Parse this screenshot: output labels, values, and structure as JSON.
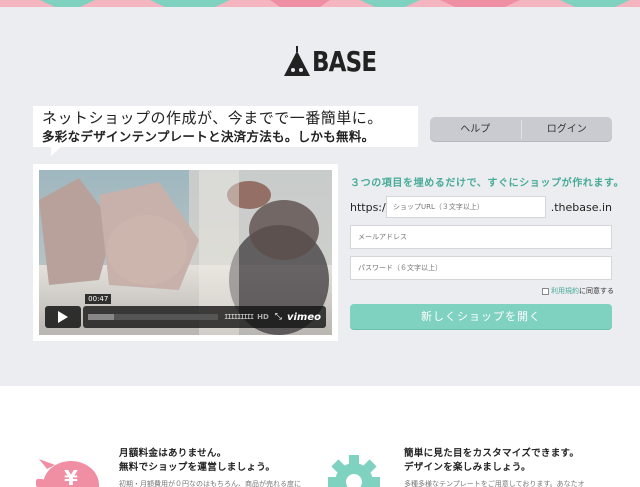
{
  "brand": {
    "name": "BASE"
  },
  "tagline": {
    "line1": "ネットショップの作成が、今までで一番簡単に。",
    "line2": "多彩なデザインテンプレートと決済方法も。しかも無料。"
  },
  "nav": {
    "help": "ヘルプ",
    "login": "ログイン"
  },
  "video": {
    "timecode": "00:47",
    "progress": 0.2,
    "volume_bars": "IIIIIIIII",
    "hd_label": "HD",
    "fullscreen_glyph": "⤡",
    "player_brand": "vimeo"
  },
  "signup": {
    "heading": "３つの項目を埋めるだけで、すぐにショップが作れます。",
    "url_prefix": "https://",
    "url_placeholder": "ショップURL（３文字以上）",
    "url_suffix": ".thebase.in",
    "email_placeholder": "メールアドレス",
    "password_placeholder": "パスワード（６文字以上）",
    "terms_link": "利用規約",
    "terms_suffix": "に同意する",
    "submit_label": "新しくショップを開く"
  },
  "features": [
    {
      "title1": "月額料金はありません。",
      "title2": "無料でショップを運営しましょう。",
      "desc": "初期・月額費用が０円なのはもちろん、商品が売れる度に"
    },
    {
      "title1": "簡単に見た目をカスタマイズできます。",
      "title2": "デザインを楽しみましょう。",
      "desc": "多種多様なテンプレートをご用意しております。あなたオ"
    }
  ],
  "colors": {
    "accent": "#47ab99",
    "button": "#7fd1c0",
    "pink": "#f08ea3",
    "background": "#ecedf0"
  },
  "icons": {
    "pig_glyph": "¥"
  }
}
